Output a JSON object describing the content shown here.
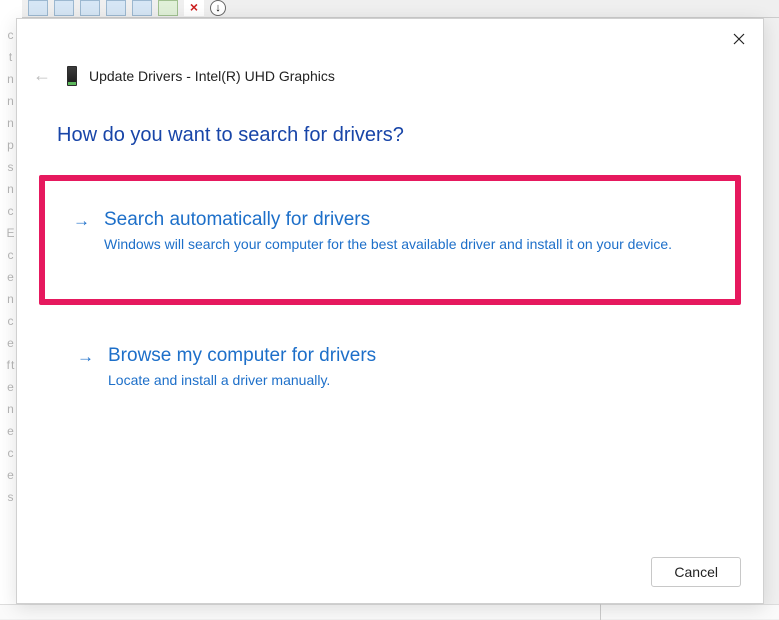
{
  "bg_letters": [
    "c",
    "t",
    "n",
    "n",
    "n",
    "",
    "p",
    "s",
    "",
    "n",
    "c",
    "E",
    "c",
    "e",
    "n",
    "c",
    "e",
    "ft",
    "e",
    "n",
    "e",
    "c",
    "e",
    "s"
  ],
  "dialog": {
    "title": "Update Drivers - Intel(R) UHD Graphics",
    "heading": "How do you want to search for drivers?",
    "options": [
      {
        "title": "Search automatically for drivers",
        "desc": "Windows will search your computer for the best available driver and install it on your device.",
        "highlighted": true
      },
      {
        "title": "Browse my computer for drivers",
        "desc": "Locate and install a driver manually.",
        "highlighted": false
      }
    ],
    "cancel_label": "Cancel"
  }
}
